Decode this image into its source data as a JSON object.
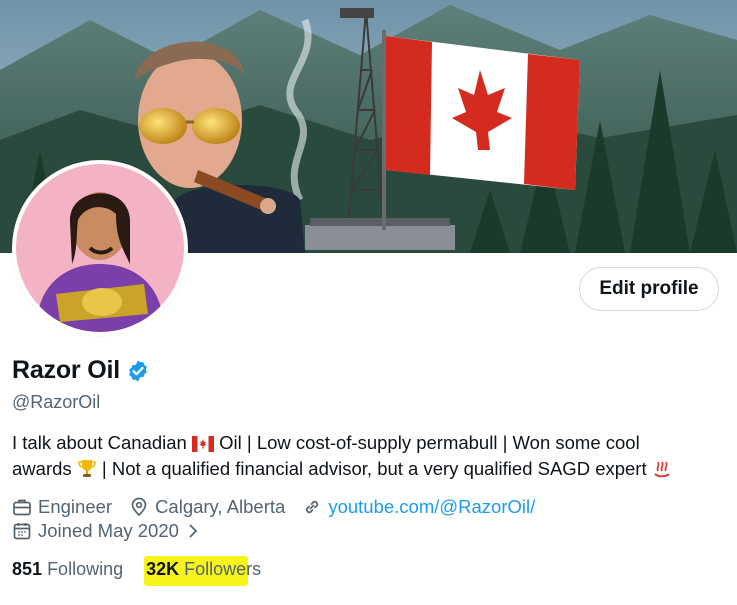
{
  "profile": {
    "name": "Razor Oil",
    "handle": "@RazorOil",
    "bio_line1_a": "I talk about Canadian",
    "bio_line1_b": "Oil | Low cost-of-supply permabull | Won some cool",
    "bio_line2_a": "awards",
    "bio_line2_b": "| Not a qualified financial advisor, but a very qualified SAGD expert",
    "occupation": "Engineer",
    "location": "Calgary, Alberta",
    "website": "youtube.com/@RazorOil/",
    "joined": "Joined May 2020",
    "following_count": "851",
    "following_label": "Following",
    "followers_count": "32K",
    "followers_label": "Followers"
  },
  "actions": {
    "edit_profile": "Edit profile"
  },
  "icons": {
    "verified": "verified-badge-icon",
    "briefcase": "briefcase-icon",
    "location": "location-pin-icon",
    "link": "link-icon",
    "calendar": "calendar-icon",
    "chevron": "chevron-right-icon"
  },
  "colors": {
    "accent": "#1d9bf0",
    "text": "#0f1419",
    "muted": "#536471",
    "highlight": "#f7f41c"
  }
}
